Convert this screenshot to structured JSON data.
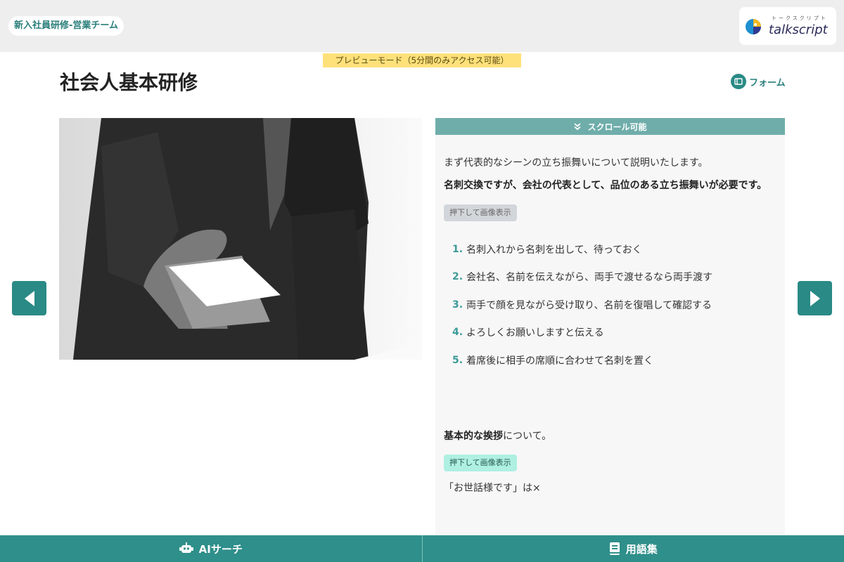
{
  "header": {
    "team_label": "新入社員研修-営業チーム",
    "logo_text": "talkscript",
    "logo_kana": "トークスクリプト"
  },
  "preview_banner": "プレビューモード（5分間のみアクセス可能）",
  "page_title": "社会人基本研修",
  "form_link": {
    "label": "フォーム",
    "icon": "form-icon"
  },
  "scroll_hint": "スクロール可能",
  "panel": {
    "intro": "まず代表的なシーンの立ち振舞いについて説明いたします。",
    "emphasis": "名刺交換ですが、会社の代表として、品位のある立ち振舞いが必要です。",
    "image_button_1": "押下して画像表示",
    "steps": [
      {
        "num": "1.",
        "text": "名刺入れから名刺を出して、待っておく"
      },
      {
        "num": "2.",
        "text": "会社名、名前を伝えながら、両手で渡せるなら両手渡す"
      },
      {
        "num": "3.",
        "text": "両手で顔を見ながら受け取り、名前を復唱して確認する"
      },
      {
        "num": "4.",
        "text": "よろしくお願いしますと伝える"
      },
      {
        "num": "5.",
        "text": "着席後に相手の席順に合わせて名刺を置く"
      }
    ],
    "greeting_bold": "基本的な挨拶",
    "greeting_rest": "について。",
    "image_button_2": "押下して画像表示",
    "quote": "「お世話様です」は×"
  },
  "bottom": {
    "ai_search": "AIサーチ",
    "glossary": "用語集"
  },
  "colors": {
    "accent": "#2f8f8a",
    "banner": "#ffe17a",
    "scroll_hint": "#6fadaa"
  }
}
